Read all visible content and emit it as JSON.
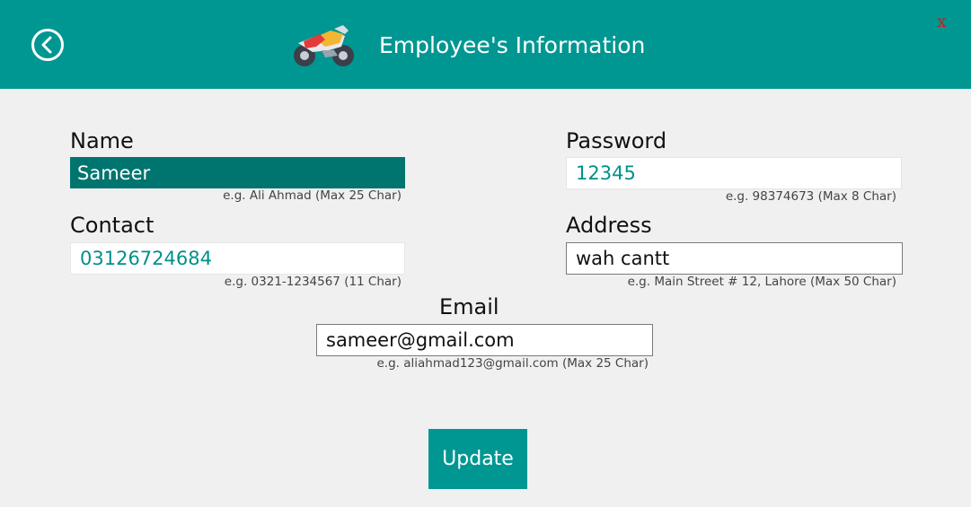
{
  "header": {
    "title": "Employee's Information",
    "back_icon": "circle-chevron-left-icon",
    "logo_icon": "motorcycle-icon",
    "close_label": "x"
  },
  "form": {
    "name": {
      "label": "Name",
      "value": "Sameer",
      "hint": "e.g. Ali Ahmad (Max 25 Char)"
    },
    "password": {
      "label": "Password",
      "value": "12345",
      "hint": "e.g. 98374673 (Max 8 Char)"
    },
    "contact": {
      "label": "Contact",
      "value": "03126724684",
      "hint": "e.g. 0321-1234567 (11 Char)"
    },
    "address": {
      "label": "Address",
      "value": "wah cantt",
      "hint": "e.g. Main Street # 12, Lahore (Max 50 Char)"
    },
    "email": {
      "label": "Email",
      "value": "sameer@gmail.com",
      "hint": "e.g. aliahmad123@gmail.com (Max 25 Char)"
    }
  },
  "actions": {
    "update_label": "Update"
  },
  "colors": {
    "header_bg": "#009792",
    "selected_field_bg": "#00756f",
    "teal_text": "#00908a",
    "close_red": "#c81e1e",
    "page_bg": "#f0f0f0"
  }
}
